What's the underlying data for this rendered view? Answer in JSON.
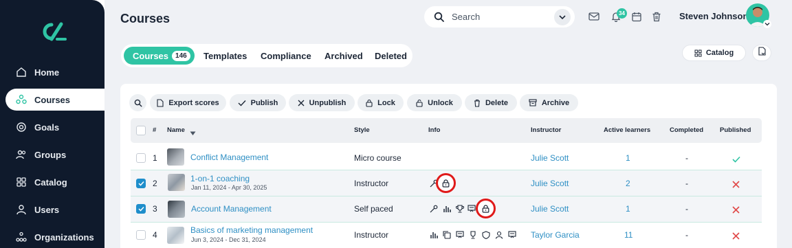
{
  "sidebar": {
    "items": [
      {
        "label": "Home",
        "icon": "home-icon",
        "active": false
      },
      {
        "label": "Courses",
        "icon": "courses-icon",
        "active": true
      },
      {
        "label": "Goals",
        "icon": "target-icon",
        "active": false
      },
      {
        "label": "Groups",
        "icon": "users-icon",
        "active": false
      },
      {
        "label": "Catalog",
        "icon": "grid-icon",
        "active": false
      },
      {
        "label": "Users",
        "icon": "user-icon",
        "active": false
      },
      {
        "label": "Organizations",
        "icon": "org-icon",
        "active": false
      }
    ]
  },
  "header": {
    "title": "Courses",
    "search_placeholder": "Search",
    "notification_count": "34",
    "user_name": "Steven Johnson"
  },
  "tabs": [
    {
      "label": "Courses",
      "count": "146",
      "active": true
    },
    {
      "label": "Templates"
    },
    {
      "label": "Compliance"
    },
    {
      "label": "Archived"
    },
    {
      "label": "Deleted"
    }
  ],
  "toolbar": {
    "catalog_label": "Catalog"
  },
  "actions": [
    {
      "label": "Export scores",
      "icon": "document-icon"
    },
    {
      "label": "Publish",
      "icon": "check-icon"
    },
    {
      "label": "Unpublish",
      "icon": "x-icon"
    },
    {
      "label": "Lock",
      "icon": "lock-icon"
    },
    {
      "label": "Unlock",
      "icon": "unlock-icon"
    },
    {
      "label": "Delete",
      "icon": "trash-icon"
    },
    {
      "label": "Archive",
      "icon": "archive-icon"
    }
  ],
  "table": {
    "headers": {
      "num": "#",
      "name": "Name",
      "style": "Style",
      "info": "Info",
      "instructor": "Instructor",
      "active_learners": "Active learners",
      "completed": "Completed",
      "published": "Published"
    },
    "rows": [
      {
        "num": "1",
        "name": "Conflict Management",
        "date": "",
        "style": "Micro course",
        "instructor": "Julie Scott",
        "active_learners": "1",
        "completed": "-",
        "published": true,
        "selected": false
      },
      {
        "num": "2",
        "name": "1-on-1 coaching",
        "date": "Jan 11, 2024 - Apr 30, 2025",
        "style": "Instructor",
        "instructor": "Julie Scott",
        "active_learners": "2",
        "completed": "-",
        "published": false,
        "selected": true
      },
      {
        "num": "3",
        "name": "Account Management",
        "date": "",
        "style": "Self paced",
        "instructor": "Julie Scott",
        "active_learners": "1",
        "completed": "-",
        "published": false,
        "selected": true
      },
      {
        "num": "4",
        "name": "Basics of marketing management",
        "date": "Jun 3, 2024 - Dec 31, 2024",
        "style": "Instructor",
        "instructor": "Taylor Garcia",
        "active_learners": "11",
        "completed": "-",
        "published": false,
        "selected": false
      }
    ]
  },
  "colors": {
    "sidebar_bg": "#0f1a2c",
    "accent": "#2fc4a4",
    "link": "#2e8fc4",
    "checkbox_on": "#1f8ecb",
    "unpublished_x": "#e04848",
    "highlight_ring": "#e01a1a"
  }
}
